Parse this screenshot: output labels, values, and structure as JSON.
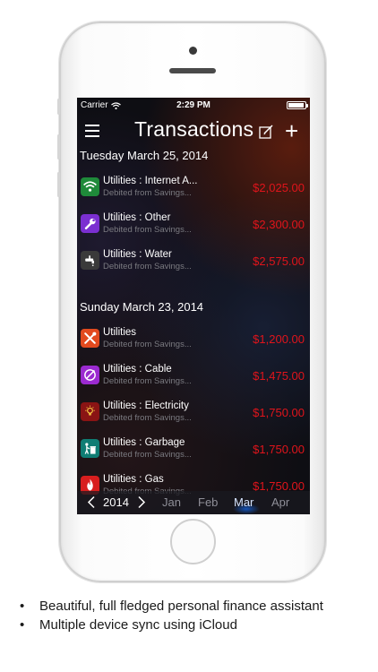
{
  "status_bar": {
    "carrier": "Carrier",
    "time": "2:29 PM",
    "battery_level": 0.92
  },
  "nav": {
    "title": "Transactions"
  },
  "sections": [
    {
      "header": "Tuesday March 25, 2014",
      "items": [
        {
          "title": "Utilities : Internet A...",
          "subtitle": "Debited from Savings...",
          "amount": "$2,025.00",
          "icon": "wifi-icon",
          "color": "#1f8a3a"
        },
        {
          "title": "Utilities : Other",
          "subtitle": "Debited from Savings...",
          "amount": "$2,300.00",
          "icon": "wrench-icon",
          "color": "#7b2fd1"
        },
        {
          "title": "Utilities : Water",
          "subtitle": "Debited from Savings...",
          "amount": "$2,575.00",
          "icon": "faucet-icon",
          "color": "#3a3a3a"
        }
      ]
    },
    {
      "header": "Sunday March 23, 2014",
      "items": [
        {
          "title": "Utilities",
          "subtitle": "Debited from Savings...",
          "amount": "$1,200.00",
          "icon": "tools-icon",
          "color": "#e24a1f"
        },
        {
          "title": "Utilities : Cable",
          "subtitle": "Debited from Savings...",
          "amount": "$1,475.00",
          "icon": "satellite-dish-icon",
          "color": "#9b2ad0"
        },
        {
          "title": "Utilities : Electricity",
          "subtitle": "Debited from Savings...",
          "amount": "$1,750.00",
          "icon": "lightbulb-icon",
          "color": "#8a1414"
        },
        {
          "title": "Utilities : Garbage",
          "subtitle": "Debited from Savings...",
          "amount": "$1,750.00",
          "icon": "trash-icon",
          "color": "#0f7d74"
        },
        {
          "title": "Utilities : Gas",
          "subtitle": "Debited from Savings...",
          "amount": "$1,750.00",
          "icon": "flame-icon",
          "color": "#d81e1e"
        }
      ]
    }
  ],
  "bottom_bar": {
    "year": "2014",
    "months": [
      "Jan",
      "Feb",
      "Mar",
      "Apr"
    ],
    "selected_month": "Mar"
  },
  "bullets": [
    "Beautiful, full fledged personal finance assistant",
    "Multiple device sync using iCloud"
  ],
  "colors": {
    "amount": "#e0141b",
    "subtitle": "#7a7a80",
    "selected_month": "#4a8df0"
  }
}
